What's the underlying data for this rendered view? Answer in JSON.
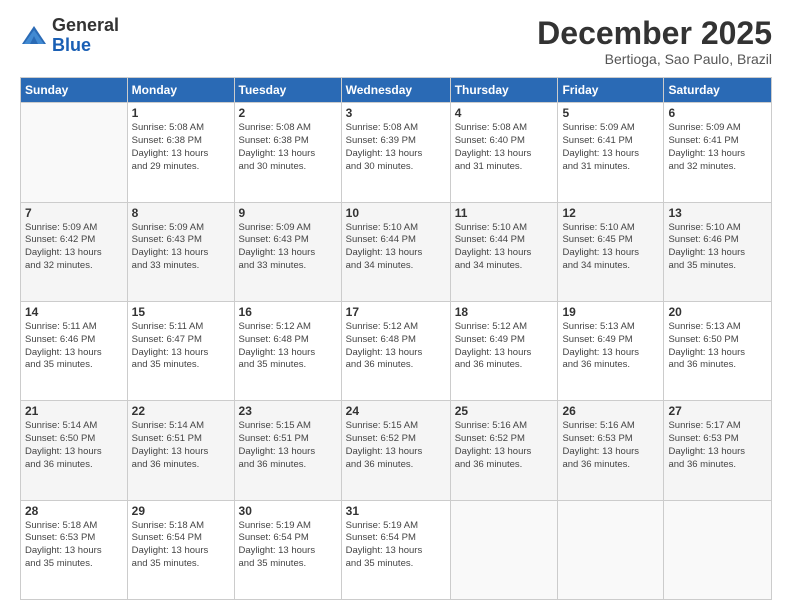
{
  "logo": {
    "general": "General",
    "blue": "Blue"
  },
  "title": "December 2025",
  "subtitle": "Bertioga, Sao Paulo, Brazil",
  "header_days": [
    "Sunday",
    "Monday",
    "Tuesday",
    "Wednesday",
    "Thursday",
    "Friday",
    "Saturday"
  ],
  "weeks": [
    [
      {
        "date": "",
        "info": ""
      },
      {
        "date": "1",
        "info": "Sunrise: 5:08 AM\nSunset: 6:38 PM\nDaylight: 13 hours\nand 29 minutes."
      },
      {
        "date": "2",
        "info": "Sunrise: 5:08 AM\nSunset: 6:38 PM\nDaylight: 13 hours\nand 30 minutes."
      },
      {
        "date": "3",
        "info": "Sunrise: 5:08 AM\nSunset: 6:39 PM\nDaylight: 13 hours\nand 30 minutes."
      },
      {
        "date": "4",
        "info": "Sunrise: 5:08 AM\nSunset: 6:40 PM\nDaylight: 13 hours\nand 31 minutes."
      },
      {
        "date": "5",
        "info": "Sunrise: 5:09 AM\nSunset: 6:41 PM\nDaylight: 13 hours\nand 31 minutes."
      },
      {
        "date": "6",
        "info": "Sunrise: 5:09 AM\nSunset: 6:41 PM\nDaylight: 13 hours\nand 32 minutes."
      }
    ],
    [
      {
        "date": "7",
        "info": "Sunrise: 5:09 AM\nSunset: 6:42 PM\nDaylight: 13 hours\nand 32 minutes."
      },
      {
        "date": "8",
        "info": "Sunrise: 5:09 AM\nSunset: 6:43 PM\nDaylight: 13 hours\nand 33 minutes."
      },
      {
        "date": "9",
        "info": "Sunrise: 5:09 AM\nSunset: 6:43 PM\nDaylight: 13 hours\nand 33 minutes."
      },
      {
        "date": "10",
        "info": "Sunrise: 5:10 AM\nSunset: 6:44 PM\nDaylight: 13 hours\nand 34 minutes."
      },
      {
        "date": "11",
        "info": "Sunrise: 5:10 AM\nSunset: 6:44 PM\nDaylight: 13 hours\nand 34 minutes."
      },
      {
        "date": "12",
        "info": "Sunrise: 5:10 AM\nSunset: 6:45 PM\nDaylight: 13 hours\nand 34 minutes."
      },
      {
        "date": "13",
        "info": "Sunrise: 5:10 AM\nSunset: 6:46 PM\nDaylight: 13 hours\nand 35 minutes."
      }
    ],
    [
      {
        "date": "14",
        "info": "Sunrise: 5:11 AM\nSunset: 6:46 PM\nDaylight: 13 hours\nand 35 minutes."
      },
      {
        "date": "15",
        "info": "Sunrise: 5:11 AM\nSunset: 6:47 PM\nDaylight: 13 hours\nand 35 minutes."
      },
      {
        "date": "16",
        "info": "Sunrise: 5:12 AM\nSunset: 6:48 PM\nDaylight: 13 hours\nand 35 minutes."
      },
      {
        "date": "17",
        "info": "Sunrise: 5:12 AM\nSunset: 6:48 PM\nDaylight: 13 hours\nand 36 minutes."
      },
      {
        "date": "18",
        "info": "Sunrise: 5:12 AM\nSunset: 6:49 PM\nDaylight: 13 hours\nand 36 minutes."
      },
      {
        "date": "19",
        "info": "Sunrise: 5:13 AM\nSunset: 6:49 PM\nDaylight: 13 hours\nand 36 minutes."
      },
      {
        "date": "20",
        "info": "Sunrise: 5:13 AM\nSunset: 6:50 PM\nDaylight: 13 hours\nand 36 minutes."
      }
    ],
    [
      {
        "date": "21",
        "info": "Sunrise: 5:14 AM\nSunset: 6:50 PM\nDaylight: 13 hours\nand 36 minutes."
      },
      {
        "date": "22",
        "info": "Sunrise: 5:14 AM\nSunset: 6:51 PM\nDaylight: 13 hours\nand 36 minutes."
      },
      {
        "date": "23",
        "info": "Sunrise: 5:15 AM\nSunset: 6:51 PM\nDaylight: 13 hours\nand 36 minutes."
      },
      {
        "date": "24",
        "info": "Sunrise: 5:15 AM\nSunset: 6:52 PM\nDaylight: 13 hours\nand 36 minutes."
      },
      {
        "date": "25",
        "info": "Sunrise: 5:16 AM\nSunset: 6:52 PM\nDaylight: 13 hours\nand 36 minutes."
      },
      {
        "date": "26",
        "info": "Sunrise: 5:16 AM\nSunset: 6:53 PM\nDaylight: 13 hours\nand 36 minutes."
      },
      {
        "date": "27",
        "info": "Sunrise: 5:17 AM\nSunset: 6:53 PM\nDaylight: 13 hours\nand 36 minutes."
      }
    ],
    [
      {
        "date": "28",
        "info": "Sunrise: 5:18 AM\nSunset: 6:53 PM\nDaylight: 13 hours\nand 35 minutes."
      },
      {
        "date": "29",
        "info": "Sunrise: 5:18 AM\nSunset: 6:54 PM\nDaylight: 13 hours\nand 35 minutes."
      },
      {
        "date": "30",
        "info": "Sunrise: 5:19 AM\nSunset: 6:54 PM\nDaylight: 13 hours\nand 35 minutes."
      },
      {
        "date": "31",
        "info": "Sunrise: 5:19 AM\nSunset: 6:54 PM\nDaylight: 13 hours\nand 35 minutes."
      },
      {
        "date": "",
        "info": ""
      },
      {
        "date": "",
        "info": ""
      },
      {
        "date": "",
        "info": ""
      }
    ]
  ]
}
